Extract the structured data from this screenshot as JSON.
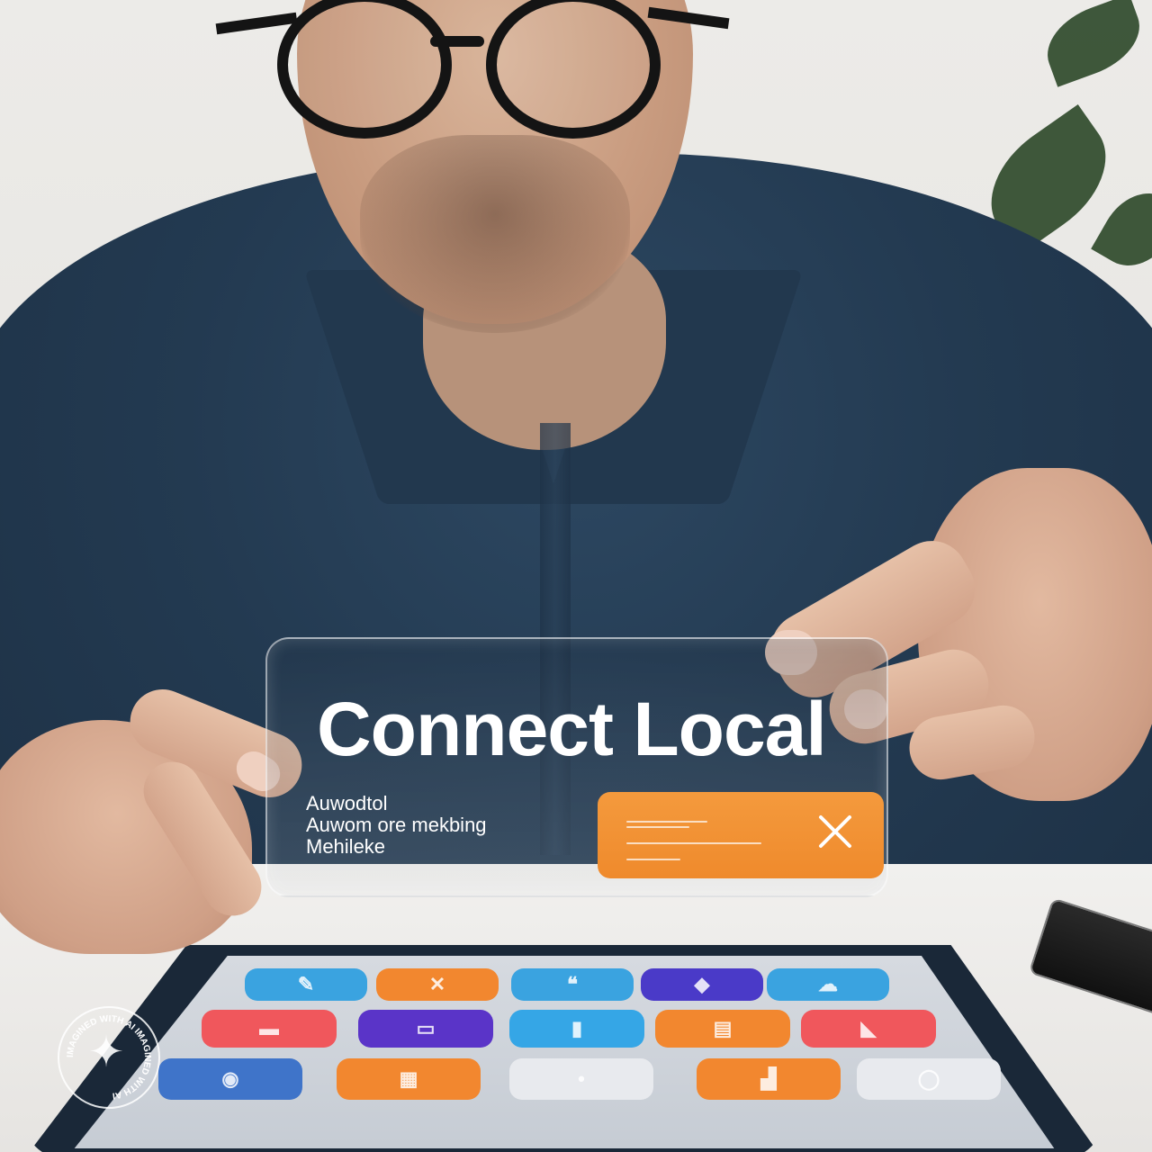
{
  "card": {
    "title": "Connect Local",
    "lines": [
      "Auwodtol",
      "Auwom ore mekbing",
      "Mehileke"
    ],
    "action_button": {
      "icon": "close-icon",
      "color": "#ef8a2c"
    }
  },
  "tablet": {
    "app_icons": [
      {
        "color": "#3aa3e0",
        "icon": "app-icon"
      },
      {
        "color": "#f2872f",
        "icon": "app-icon"
      },
      {
        "color": "#3aa3e0",
        "icon": "app-icon"
      },
      {
        "color": "#4a3ac8",
        "icon": "app-icon"
      },
      {
        "color": "#3aa3e0",
        "icon": "app-icon"
      },
      {
        "color": "#f0575c",
        "icon": "app-icon"
      },
      {
        "color": "#5a34c8",
        "icon": "app-icon"
      },
      {
        "color": "#35a6e6",
        "icon": "app-icon"
      },
      {
        "color": "#f2872f",
        "icon": "app-icon"
      },
      {
        "color": "#f0575c",
        "icon": "app-icon"
      },
      {
        "color": "#3f74c9",
        "icon": "app-icon"
      },
      {
        "color": "#f2872f",
        "icon": "app-icon"
      },
      {
        "color": "#e8eaee",
        "icon": "app-icon"
      },
      {
        "color": "#f2872f",
        "icon": "app-icon"
      },
      {
        "color": "#e8eaee",
        "icon": "app-icon"
      }
    ]
  },
  "watermark": {
    "text": "IMAGINED WITH AI IMAGINED WITH AI",
    "icon": "sparkle-icon"
  }
}
